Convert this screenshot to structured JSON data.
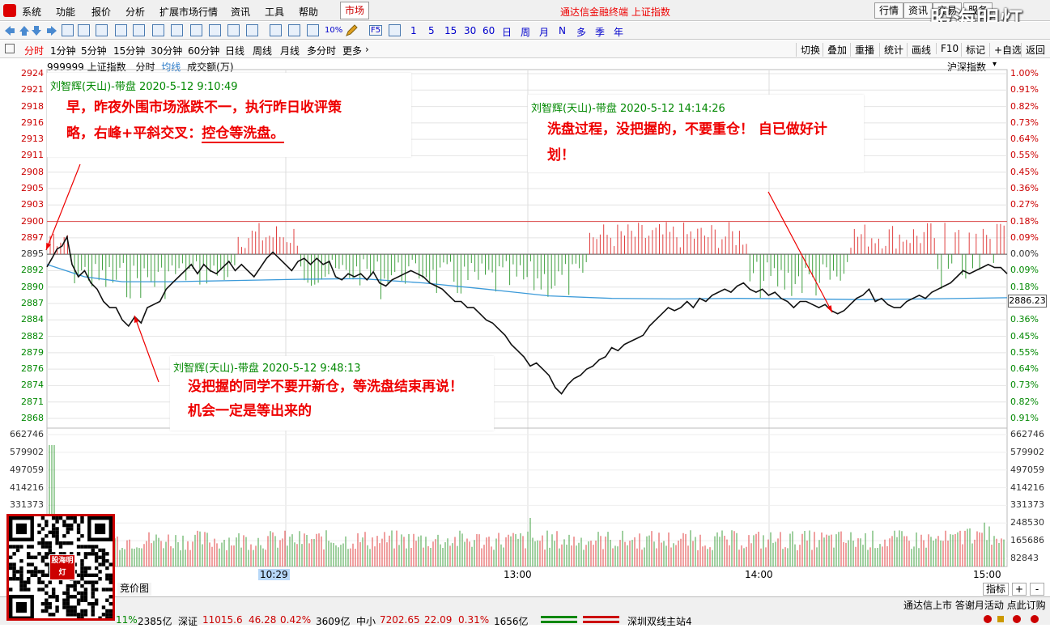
{
  "menu": [
    "系统",
    "功能",
    "报价",
    "分析",
    "扩展市场行情",
    "资讯",
    "工具",
    "帮助"
  ],
  "market_tab": "市场",
  "app_title": "通达信金融终端 上证指数",
  "right_buttons": [
    "行情",
    "资讯",
    "交易",
    "服务"
  ],
  "watermark": "股海明灯",
  "toolbar_text": [
    "10%",
    "F5",
    "1",
    "5",
    "15",
    "30",
    "60",
    "日",
    "周",
    "月",
    "N",
    "多",
    "季",
    "年"
  ],
  "periods": [
    "分时",
    "1分钟",
    "5分钟",
    "15分钟",
    "30分钟",
    "60分钟",
    "日线",
    "周线",
    "月线",
    "多分时",
    "更多"
  ],
  "tools": [
    "切换",
    "叠加",
    "重播",
    "统计",
    "画线",
    "F10",
    "标记",
    "+自选",
    "返回"
  ],
  "info": {
    "code_name": "999999 上证指数",
    "mode": "分时",
    "avg": "均线",
    "vol": "成交额(万)",
    "index_label": "沪深指数"
  },
  "price_labels": [
    "2924",
    "2921",
    "2918",
    "2916",
    "2913",
    "2911",
    "2908",
    "2905",
    "2903",
    "2900",
    "2897",
    "2895",
    "2892",
    "2890",
    "2887",
    "2884",
    "2882",
    "2879",
    "2876",
    "2874",
    "2871",
    "2868"
  ],
  "pct_labels": [
    "1.00%",
    "0.91%",
    "0.82%",
    "0.73%",
    "0.64%",
    "0.55%",
    "0.45%",
    "0.36%",
    "0.27%",
    "0.18%",
    "0.09%",
    "0.00%",
    "0.09%",
    "0.18%",
    "0.27%",
    "0.36%",
    "0.45%",
    "0.55%",
    "0.64%",
    "0.73%",
    "0.82%",
    "0.91%"
  ],
  "vol_labels": [
    "662746",
    "579902",
    "497059",
    "414216",
    "331373",
    "248530",
    "165686",
    "82843"
  ],
  "current_price": "2886.23",
  "time_labels": [
    "10:29",
    "13:00",
    "14:00",
    "15:00"
  ],
  "notes": [
    {
      "header": "刘智辉(天山)-带盘 2020-5-12 9:10:49",
      "line1": "早，昨夜外围市场涨跌不一，执行昨日收评策",
      "line2a": "略，右峰+平斜交叉：",
      "line2b": "控仓等洗盘。"
    },
    {
      "header": "刘智辉(天山)-带盘 2020-5-12 14:14:26",
      "line1": "洗盘过程，没把握的，不要重仓！ 自已做好计",
      "line2": "划！"
    },
    {
      "header": "刘智辉(天山)-带盘 2020-5-12 9:48:13",
      "line1": "没把握的同学不要开新仓，等洗盘结束再说！",
      "line2": "机会一定是等出来的"
    }
  ],
  "bottom": {
    "tab": "竞价图",
    "right_tab": "指标",
    "plus": "+",
    "minus": "-",
    "ticker": "通达信上市 答谢月活动 点此订购",
    "sh_pct": "11%",
    "sh_amt": "2385亿",
    "sz_name": "深证",
    "sz_price": "11015.6",
    "sz_chg": "46.28",
    "sz_pct": "0.42%",
    "sz_amt": "3609亿",
    "zx_name": "中小",
    "zx_price": "7202.65",
    "zx_chg": "22.09",
    "zx_pct": "0.31%",
    "zx_amt": "1656亿",
    "server": "深圳双线主站4"
  },
  "qr_stamp": "股海明灯",
  "chart_data": {
    "type": "line",
    "prev_close": 2895,
    "ylim": [
      2867,
      2924
    ],
    "price": [
      [
        0,
        2892.6
      ],
      [
        4,
        2894
      ],
      [
        8,
        2895.5
      ],
      [
        12,
        2896
      ],
      [
        16,
        2897.5
      ],
      [
        20,
        2893
      ],
      [
        25,
        2891
      ],
      [
        30,
        2892
      ],
      [
        35,
        2890
      ],
      [
        40,
        2889
      ],
      [
        45,
        2887
      ],
      [
        50,
        2886
      ],
      [
        55,
        2886
      ],
      [
        60,
        2884
      ],
      [
        65,
        2883
      ],
      [
        70,
        2884.5
      ],
      [
        75,
        2883.5
      ],
      [
        80,
        2886
      ],
      [
        85,
        2886.5
      ],
      [
        90,
        2887
      ],
      [
        95,
        2889
      ],
      [
        100,
        2890
      ],
      [
        105,
        2891
      ],
      [
        110,
        2892
      ],
      [
        115,
        2893
      ],
      [
        120,
        2891.5
      ],
      [
        125,
        2893
      ],
      [
        130,
        2892
      ],
      [
        135,
        2891.5
      ],
      [
        140,
        2892.5
      ],
      [
        145,
        2893.5
      ],
      [
        150,
        2892
      ],
      [
        155,
        2893
      ],
      [
        160,
        2892
      ],
      [
        165,
        2891
      ],
      [
        170,
        2892.5
      ],
      [
        175,
        2894
      ],
      [
        180,
        2895
      ],
      [
        185,
        2894
      ],
      [
        190,
        2893
      ],
      [
        195,
        2892
      ],
      [
        200,
        2893.5
      ],
      [
        205,
        2894
      ],
      [
        210,
        2893
      ],
      [
        215,
        2894
      ],
      [
        220,
        2893
      ],
      [
        225,
        2893.5
      ],
      [
        230,
        2891
      ],
      [
        235,
        2890.5
      ],
      [
        240,
        2891.5
      ],
      [
        245,
        2891
      ],
      [
        250,
        2891.5
      ],
      [
        255,
        2890.5
      ],
      [
        260,
        2891.8
      ],
      [
        265,
        2890
      ],
      [
        270,
        2889.5
      ],
      [
        275,
        2890.5
      ],
      [
        280,
        2891
      ],
      [
        285,
        2891.5
      ],
      [
        290,
        2892
      ],
      [
        295,
        2891.5
      ],
      [
        300,
        2891
      ],
      [
        305,
        2890
      ],
      [
        310,
        2889.5
      ],
      [
        315,
        2889
      ],
      [
        320,
        2888
      ],
      [
        325,
        2887
      ],
      [
        330,
        2887
      ],
      [
        335,
        2886
      ],
      [
        340,
        2886
      ],
      [
        345,
        2885
      ],
      [
        350,
        2884
      ],
      [
        355,
        2883.5
      ],
      [
        360,
        2882.5
      ],
      [
        365,
        2881.5
      ],
      [
        370,
        2880
      ],
      [
        375,
        2879
      ],
      [
        380,
        2878
      ],
      [
        385,
        2876.5
      ],
      [
        390,
        2877
      ],
      [
        395,
        2876
      ],
      [
        400,
        2875
      ],
      [
        405,
        2873
      ],
      [
        410,
        2872
      ],
      [
        415,
        2873.5
      ],
      [
        420,
        2874.5
      ],
      [
        425,
        2875
      ],
      [
        430,
        2876
      ],
      [
        435,
        2876.5
      ],
      [
        440,
        2877.5
      ],
      [
        445,
        2878
      ],
      [
        450,
        2879.5
      ],
      [
        455,
        2879
      ],
      [
        460,
        2880
      ],
      [
        465,
        2880.5
      ],
      [
        470,
        2881
      ],
      [
        475,
        2881.5
      ],
      [
        480,
        2883
      ],
      [
        485,
        2884
      ],
      [
        490,
        2885
      ],
      [
        495,
        2886
      ],
      [
        500,
        2885.5
      ],
      [
        505,
        2886
      ],
      [
        510,
        2887
      ],
      [
        515,
        2886
      ],
      [
        520,
        2887.5
      ],
      [
        525,
        2887
      ],
      [
        530,
        2888
      ],
      [
        535,
        2888.5
      ],
      [
        540,
        2889
      ],
      [
        545,
        2888.5
      ],
      [
        550,
        2889.5
      ],
      [
        555,
        2890
      ],
      [
        560,
        2889
      ],
      [
        565,
        2888.5
      ],
      [
        570,
        2889
      ],
      [
        575,
        2888
      ],
      [
        580,
        2888.5
      ],
      [
        585,
        2887.5
      ],
      [
        590,
        2887
      ],
      [
        595,
        2886
      ],
      [
        600,
        2887
      ],
      [
        605,
        2887
      ],
      [
        610,
        2886.5
      ],
      [
        615,
        2886
      ],
      [
        620,
        2886.5
      ],
      [
        625,
        2885.5
      ],
      [
        630,
        2885
      ],
      [
        635,
        2885.5
      ],
      [
        640,
        2886.5
      ],
      [
        645,
        2887.5
      ],
      [
        650,
        2888
      ],
      [
        655,
        2889
      ],
      [
        660,
        2887
      ],
      [
        665,
        2887.5
      ],
      [
        670,
        2886.5
      ],
      [
        675,
        2886
      ],
      [
        680,
        2886
      ],
      [
        685,
        2887
      ],
      [
        690,
        2887.5
      ],
      [
        695,
        2888
      ],
      [
        700,
        2887.5
      ],
      [
        705,
        2888.5
      ],
      [
        710,
        2889
      ],
      [
        715,
        2889.5
      ],
      [
        720,
        2890
      ],
      [
        725,
        2891
      ],
      [
        730,
        2892
      ],
      [
        735,
        2891.5
      ],
      [
        740,
        2892
      ],
      [
        745,
        2892.5
      ],
      [
        750,
        2893
      ],
      [
        755,
        2892.5
      ],
      [
        760,
        2892.5
      ],
      [
        765,
        2891.5
      ]
    ],
    "avg_price": [
      [
        0,
        2893
      ],
      [
        30,
        2891
      ],
      [
        60,
        2890.2
      ],
      [
        100,
        2890.2
      ],
      [
        150,
        2890.4
      ],
      [
        200,
        2890.6
      ],
      [
        250,
        2890.7
      ],
      [
        300,
        2890
      ],
      [
        350,
        2889
      ],
      [
        400,
        2887.9
      ],
      [
        450,
        2887.5
      ],
      [
        500,
        2887.4
      ],
      [
        550,
        2887.5
      ],
      [
        600,
        2887.4
      ],
      [
        650,
        2887.3
      ],
      [
        700,
        2887.4
      ],
      [
        765,
        2887.6
      ]
    ],
    "current": 2886.23
  }
}
